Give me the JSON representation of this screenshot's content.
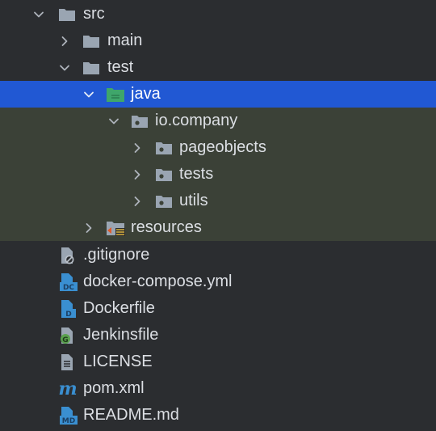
{
  "tree": {
    "src": {
      "label": "src",
      "icon": "folder-icon"
    },
    "main": {
      "label": "main",
      "icon": "folder-icon"
    },
    "test": {
      "label": "test",
      "icon": "folder-icon"
    },
    "java": {
      "label": "java",
      "icon": "test-sources-folder-icon"
    },
    "io_company": {
      "label": "io.company",
      "icon": "package-icon"
    },
    "pageobjects": {
      "label": "pageobjects",
      "icon": "package-icon"
    },
    "tests": {
      "label": "tests",
      "icon": "package-icon"
    },
    "utils": {
      "label": "utils",
      "icon": "package-icon"
    },
    "resources": {
      "label": "resources",
      "icon": "test-resources-folder-icon"
    },
    "files": [
      {
        "label": ".gitignore",
        "icon": "gitignore-file-icon"
      },
      {
        "label": "docker-compose.yml",
        "icon": "docker-compose-file-icon",
        "badge": "DC"
      },
      {
        "label": "Dockerfile",
        "icon": "dockerfile-icon",
        "badge": "D"
      },
      {
        "label": "Jenkinsfile",
        "icon": "groovy-file-icon",
        "badge": "G"
      },
      {
        "label": "LICENSE",
        "icon": "text-file-icon"
      },
      {
        "label": "pom.xml",
        "icon": "maven-file-icon",
        "badge": "m"
      },
      {
        "label": "README.md",
        "icon": "markdown-file-icon",
        "badge": "MD"
      }
    ]
  },
  "colors": {
    "background": "#2b2d30",
    "scope_highlight": "#3b4137",
    "selection": "#2158d3",
    "folder": "#9aa5b2",
    "test_folder": "#3fa66b",
    "file_badge": "#3a8fd1",
    "groovy": "#5aa14e",
    "maven": "#3a8fd1",
    "text": "#dcdfe4"
  }
}
